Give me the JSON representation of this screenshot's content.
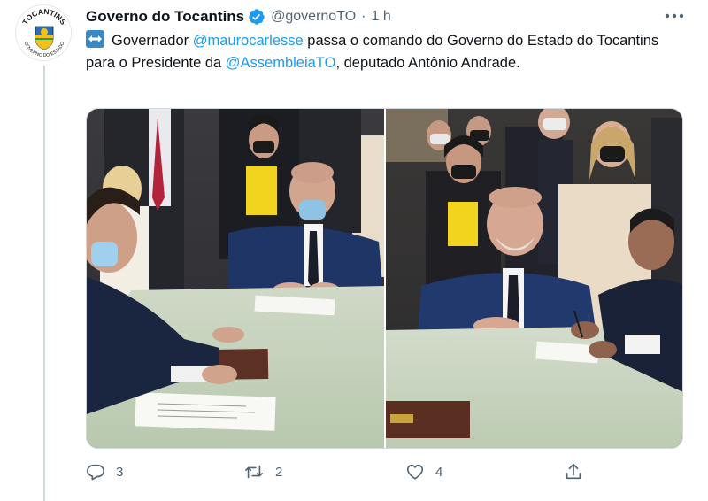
{
  "tweet": {
    "author_name": "Governo do Tocantins",
    "handle": "@governoTO",
    "separator": "·",
    "time": "1 h",
    "verified_icon": "verified-badge-icon",
    "more_icon": "more-options-icon",
    "avatar": {
      "logo_text_top": "TOCANTINS",
      "logo_text_bottom": "GOVERNO DO ESTADO"
    },
    "text": {
      "emoji": "left-right-arrow-emoji",
      "part1": "Governador ",
      "mention1": "@maurocarlesse",
      "part2": " passa o comando do Governo do Estado do Tocantins para o Presidente da ",
      "mention2": "@AssembleiaTO",
      "part3": ", deputado Antônio Andrade."
    },
    "media": {
      "photos": [
        "photo-signing-1",
        "photo-signing-2"
      ]
    },
    "actions": {
      "reply_count": "3",
      "retweet_count": "2",
      "like_count": "4"
    },
    "colors": {
      "link": "#1d9bf0",
      "secondary_text": "#536471",
      "verified": "#1d9bf0"
    }
  }
}
